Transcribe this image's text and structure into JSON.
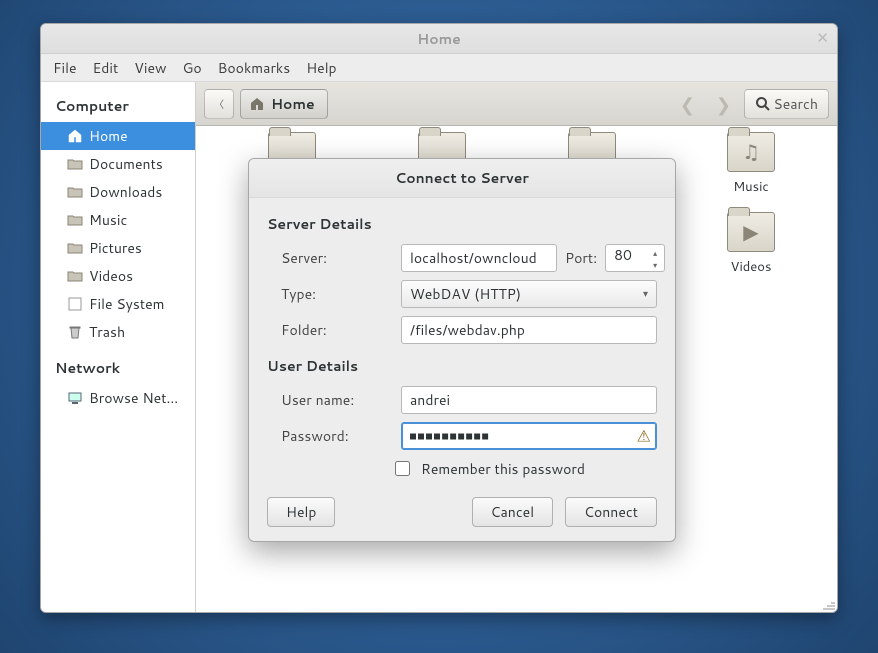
{
  "window": {
    "title": "Home"
  },
  "menu": {
    "file": "File",
    "edit": "Edit",
    "view": "View",
    "go": "Go",
    "bookmarks": "Bookmarks",
    "help": "Help"
  },
  "sidebar": {
    "section1": "Computer",
    "items": [
      {
        "label": "Home"
      },
      {
        "label": "Documents"
      },
      {
        "label": "Downloads"
      },
      {
        "label": "Music"
      },
      {
        "label": "Pictures"
      },
      {
        "label": "Videos"
      },
      {
        "label": "File System"
      },
      {
        "label": "Trash"
      }
    ],
    "section2": "Network",
    "netitems": [
      {
        "label": "Browse Net..."
      }
    ]
  },
  "toolbar": {
    "path": "Home",
    "search": "Search"
  },
  "grid": {
    "music": "Music",
    "videos": "Videos"
  },
  "dialog": {
    "title": "Connect to Server",
    "sect_server": "Server Details",
    "server_label": "Server:",
    "server_value": "localhost/owncloud",
    "port_label": "Port:",
    "port_value": "80",
    "type_label": "Type:",
    "type_value": "WebDAV (HTTP)",
    "folder_label": "Folder:",
    "folder_value": "/files/webdav.php",
    "sect_user": "User Details",
    "user_label": "User name:",
    "user_value": "andrei",
    "pass_label": "Password:",
    "pass_value": "■■■■■■■■■■",
    "remember": "Remember this password",
    "help": "Help",
    "cancel": "Cancel",
    "connect": "Connect"
  }
}
